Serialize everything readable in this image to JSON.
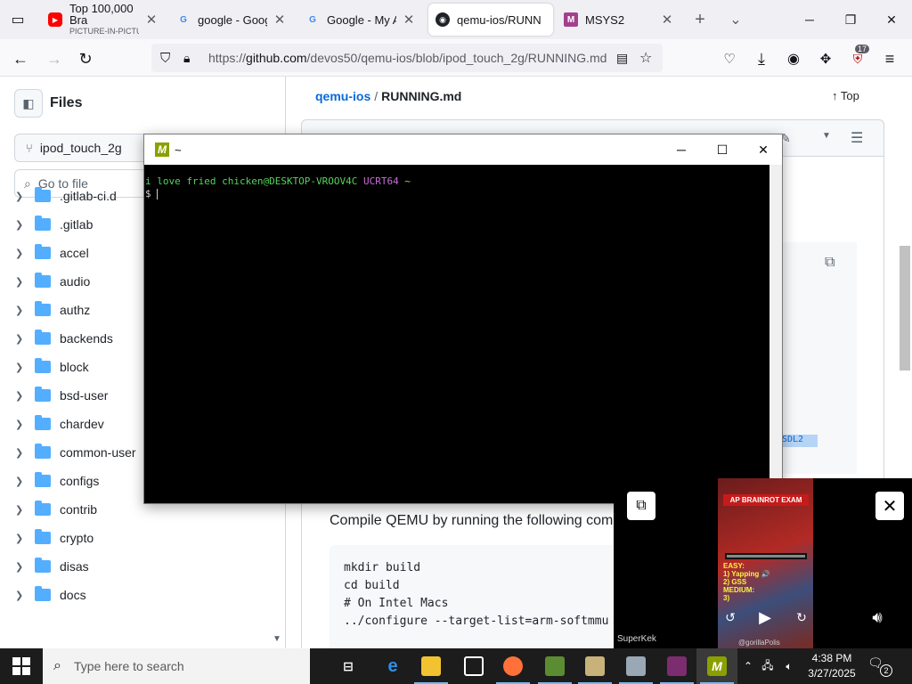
{
  "browser": {
    "tabs": [
      {
        "title": "Top 100,000 Bra",
        "subtitle": "PICTURE-IN-PICTURE",
        "icon": "youtube-icon"
      },
      {
        "title": "google - Google",
        "icon": "google-icon"
      },
      {
        "title": "Google - My Ac",
        "icon": "google-icon"
      },
      {
        "title": "qemu-ios/RUNN",
        "icon": "github-icon"
      },
      {
        "title": "MSYS2",
        "icon": "msys2-icon"
      }
    ],
    "new_tab": "+",
    "list_tabs": "⌄",
    "close": "✕",
    "url_prefix": "https://",
    "url_host": "github.com",
    "url_path": "/devos50/qemu-ios/blob/ipod_touch_2g/RUNNING.md",
    "extensions_badge": "17"
  },
  "github": {
    "files_title": "Files",
    "branch": "ipod_touch_2g",
    "goto_placeholder": "Go to file",
    "tree": [
      ".gitlab-ci.d",
      ".gitlab",
      "accel",
      "audio",
      "authz",
      "backends",
      "block",
      "bsd-user",
      "chardev",
      "common-user",
      "configs",
      "contrib",
      "crypto",
      "disas",
      "docs"
    ],
    "breadcrumb_repo": "qemu-ios",
    "breadcrumb_sep": "/",
    "breadcrumb_file": "RUNNING.md",
    "top_label": "Top",
    "compile_text": "Compile QEMU by running the following com",
    "code_lines": [
      "mkdir build",
      "cd build",
      "",
      "# On Intel Macs",
      "../configure --target-list=arm-softmmu"
    ],
    "sdl_fragment": "SDL2"
  },
  "terminal": {
    "title": "~",
    "prompt_user": "i love fried chicken@DESKTOP-VROOV4C",
    "prompt_system": "UCRT64",
    "prompt_path": "~",
    "prompt_symbol": "$"
  },
  "pip": {
    "banner": "AP BRAINROT EXAM",
    "lines": [
      "EASY:",
      "1) Yapping 🔊",
      "2) GSS",
      "MEDIUM:",
      "3)"
    ],
    "watermark": "SuperKek",
    "credit": "@gorillaPolis"
  },
  "taskbar": {
    "search_placeholder": "Type here to search",
    "time": "4:38 PM",
    "date": "3/27/2025",
    "notifications": "2"
  },
  "colors": {
    "terminal_user": "#55d35b",
    "terminal_system": "#c76cd8",
    "terminal_path": "#d7c64c",
    "github_link": "#0969da",
    "taskbar": "#1c1c1c"
  }
}
